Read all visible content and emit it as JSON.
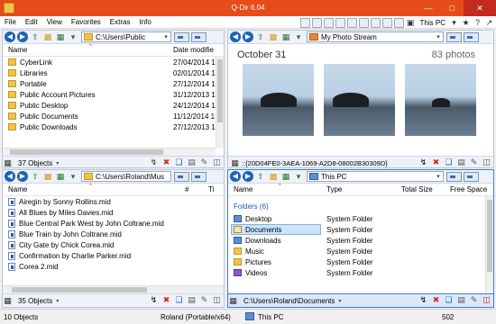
{
  "window": {
    "title": "Q-Dir 6.04"
  },
  "menu": {
    "items": [
      "File",
      "Edit",
      "View",
      "Favorites",
      "Extras",
      "Info"
    ],
    "location_label": "This PC"
  },
  "pane_top_left": {
    "path": "C:\\Users\\Public",
    "columns": {
      "name": "Name",
      "date": "Date modifie"
    },
    "rows": [
      {
        "name": "CyberLink",
        "date": "27/04/2014 1"
      },
      {
        "name": "Libraries",
        "date": "02/01/2014 1"
      },
      {
        "name": "Portable",
        "date": "27/12/2014 1"
      },
      {
        "name": "Public Account Pictures",
        "date": "31/12/2013 1"
      },
      {
        "name": "Public Desktop",
        "date": "24/12/2014 1"
      },
      {
        "name": "Public Documents",
        "date": "11/12/2014 1"
      },
      {
        "name": "Public Downloads",
        "date": "27/12/2013 1"
      }
    ],
    "status": "37 Objects"
  },
  "pane_top_right": {
    "path": "My Photo Stream",
    "album_title": "October 31",
    "photo_count": "83 photos",
    "guid_path": "::{20D04FE0-3AEA-1069-A2D8-08002B30309D}"
  },
  "pane_bottom_left": {
    "path": "C:\\Users\\Roland\\Mus",
    "columns": {
      "name": "Name",
      "num": "#",
      "ti": "Ti"
    },
    "rows": [
      "Airegin by Sonny Rollins.mid",
      "All Blues by Miles Davies.mid",
      "Blue Central Park West by John Coltrane.mid",
      "Blue Train by John Coltrane.mid",
      "City Gate by Chick Corea.mid",
      "Confirmation by Charlie Parker.mid",
      "Corea 2.mid"
    ],
    "status": "35 Objects"
  },
  "pane_bottom_right": {
    "path": "This PC",
    "columns": {
      "name": "Name",
      "type": "Type",
      "total": "Total Size",
      "free": "Free Space"
    },
    "section": "Folders (6)",
    "rows": [
      {
        "name": "Desktop",
        "type": "System Folder"
      },
      {
        "name": "Documents",
        "type": "System Folder"
      },
      {
        "name": "Downloads",
        "type": "System Folder"
      },
      {
        "name": "Music",
        "type": "System Folder"
      },
      {
        "name": "Pictures",
        "type": "System Folder"
      },
      {
        "name": "Videos",
        "type": "System Folder"
      }
    ],
    "status_path": "C:\\Users\\Roland\\Documents"
  },
  "statusbar": {
    "objects": "10 Objects",
    "user": "Roland (Portable/x64)",
    "location": "This PC",
    "number": "502"
  }
}
